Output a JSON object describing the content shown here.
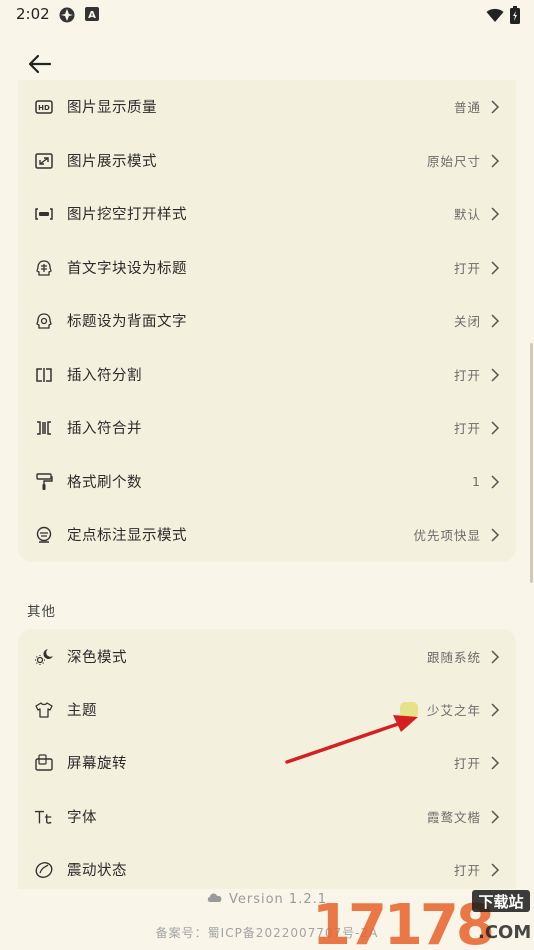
{
  "status_bar": {
    "time": "2:02"
  },
  "group1": {
    "items": [
      {
        "label": "图片显示质量",
        "value": "普通",
        "icon": "hd-icon"
      },
      {
        "label": "图片展示模式",
        "value": "原始尺寸",
        "icon": "image-resize-icon"
      },
      {
        "label": "图片挖空打开样式",
        "value": "默认",
        "icon": "cloze-block-icon"
      },
      {
        "label": "首文字块设为标题",
        "value": "打开",
        "icon": "brain-icon"
      },
      {
        "label": "标题设为背面文字",
        "value": "关闭",
        "icon": "brain-icon"
      },
      {
        "label": "插入符分割",
        "value": "打开",
        "icon": "split-icon"
      },
      {
        "label": "插入符合并",
        "value": "打开",
        "icon": "merge-icon"
      },
      {
        "label": "格式刷个数",
        "value": "1",
        "icon": "paint-roller-icon"
      },
      {
        "label": "定点标注显示模式",
        "value": "优先项快显",
        "icon": "marker-icon"
      }
    ]
  },
  "section_other": {
    "title": "其他"
  },
  "group2": {
    "items": [
      {
        "label": "深色模式",
        "value": "跟随系统",
        "icon": "sun-moon-icon"
      },
      {
        "label": "主题",
        "value": "少艾之年",
        "icon": "tshirt-icon",
        "swatch_color": "#e6e28a"
      },
      {
        "label": "屏幕旋转",
        "value": "打开",
        "icon": "rotate-screen-icon"
      },
      {
        "label": "字体",
        "value": "霞鹜文楷",
        "icon": "font-icon"
      },
      {
        "label": "震动状态",
        "value": "打开",
        "icon": "vibration-icon"
      }
    ]
  },
  "footer": {
    "version": "Version 1.2.1",
    "beian": "备案号：蜀ICP备2022007707号-2A"
  },
  "watermark": {
    "text": "17178",
    "badge": "下载站",
    "domain": ".COM"
  },
  "colors": {
    "background": "#f9f6e9",
    "card": "#f4f0de",
    "swatch": "#e6e28a",
    "annotation_arrow": "#d42020"
  }
}
